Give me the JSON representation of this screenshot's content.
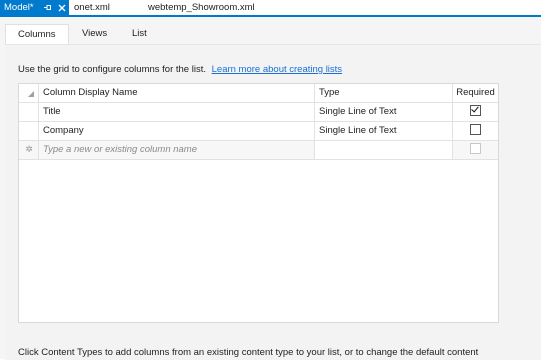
{
  "doc_tabs": [
    {
      "label": "Model*",
      "active": true
    },
    {
      "label": "onet.xml",
      "active": false
    },
    {
      "label": "webtemp_Showroom.xml",
      "active": false
    }
  ],
  "tab_icons": {
    "pin": "pin-icon",
    "close": "close-icon"
  },
  "designer_tabs": [
    "Columns",
    "Views",
    "List"
  ],
  "intro": {
    "text": "Use the grid to configure columns for the list.",
    "link": "Learn more about creating lists"
  },
  "grid": {
    "headers": {
      "name": "Column Display Name",
      "type": "Type",
      "required": "Required"
    },
    "rows": [
      {
        "name": "Title",
        "type": "Single Line of Text",
        "required": true
      },
      {
        "name": "Company",
        "type": "Single Line of Text",
        "required": false
      }
    ],
    "new_row_placeholder": "Type a new or existing column name"
  },
  "footer_text": "Click Content Types to add columns from an existing content type to your list, or to change the default content",
  "colors": {
    "accent": "#007acc",
    "link": "#1a6fd6"
  }
}
